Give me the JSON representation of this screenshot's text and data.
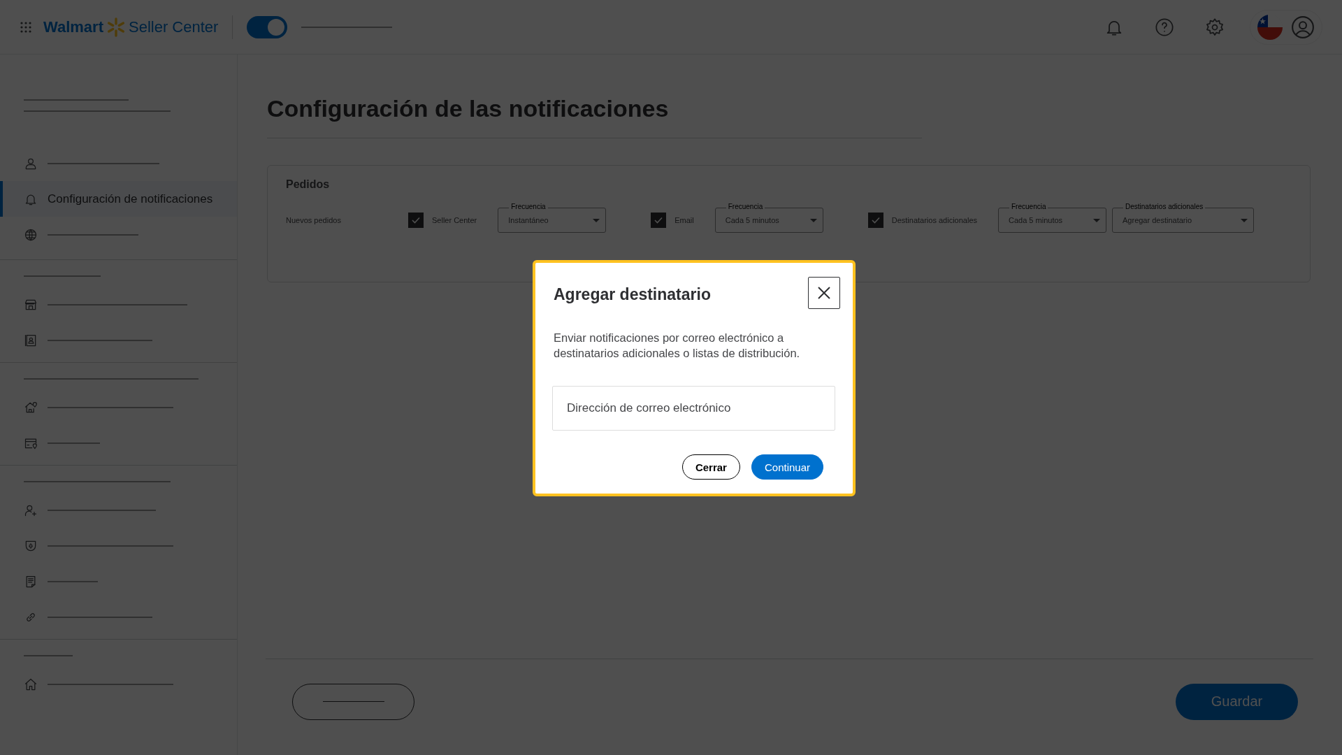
{
  "header": {
    "logo": {
      "brand": "Walmart",
      "product": "Seller Center"
    },
    "toggle": {
      "on": true
    }
  },
  "sidebar": {
    "sections": [
      {
        "items": [
          {
            "kind": "person",
            "selected": false
          },
          {
            "kind": "bell",
            "selected": true,
            "label": "Configuración de notificaciones"
          },
          {
            "kind": "globe",
            "selected": false
          }
        ]
      },
      {
        "items": [
          {
            "kind": "store",
            "selected": false
          },
          {
            "kind": "contact",
            "selected": false
          }
        ]
      },
      {
        "items": [
          {
            "kind": "house-pin",
            "selected": false
          },
          {
            "kind": "card-pin",
            "selected": false
          }
        ]
      },
      {
        "items": [
          {
            "kind": "person-plus",
            "selected": false
          },
          {
            "kind": "shield",
            "selected": false
          },
          {
            "kind": "document",
            "selected": false
          },
          {
            "kind": "link",
            "selected": false
          }
        ]
      },
      {
        "items": [
          {
            "kind": "home",
            "selected": false
          }
        ]
      }
    ]
  },
  "page": {
    "title": "Configuración de las notificaciones",
    "card": {
      "title": "Pedidos",
      "rows": [
        {
          "label": "Nuevos pedidos",
          "channels": [
            {
              "name": "Seller Center",
              "checked": true,
              "selects": [
                {
                  "label": "Frecuencia",
                  "value": "Instantáneo"
                }
              ]
            },
            {
              "name": "Email",
              "checked": true,
              "selects": [
                {
                  "label": "Frecuencia",
                  "value": "Cada 5 minutos"
                }
              ]
            },
            {
              "name": "Destinatarios adicionales",
              "checked": true,
              "selects": [
                {
                  "label": "Frecuencia",
                  "value": "Cada 5 minutos"
                },
                {
                  "label": "Destinatarios adicionales",
                  "value": "Agregar destinatario"
                }
              ]
            }
          ]
        }
      ]
    },
    "save_button": "Guardar"
  },
  "dialog": {
    "title": "Agregar destinatario",
    "text": "Enviar notificaciones por correo electrónico a destinatarios adicionales o listas de distribución.",
    "input": {
      "placeholder": "Dirección de correo electrónico"
    },
    "buttons": [
      {
        "label": "Cerrar",
        "kind": "secondary"
      },
      {
        "label": "Continuar",
        "kind": "primary"
      }
    ]
  }
}
